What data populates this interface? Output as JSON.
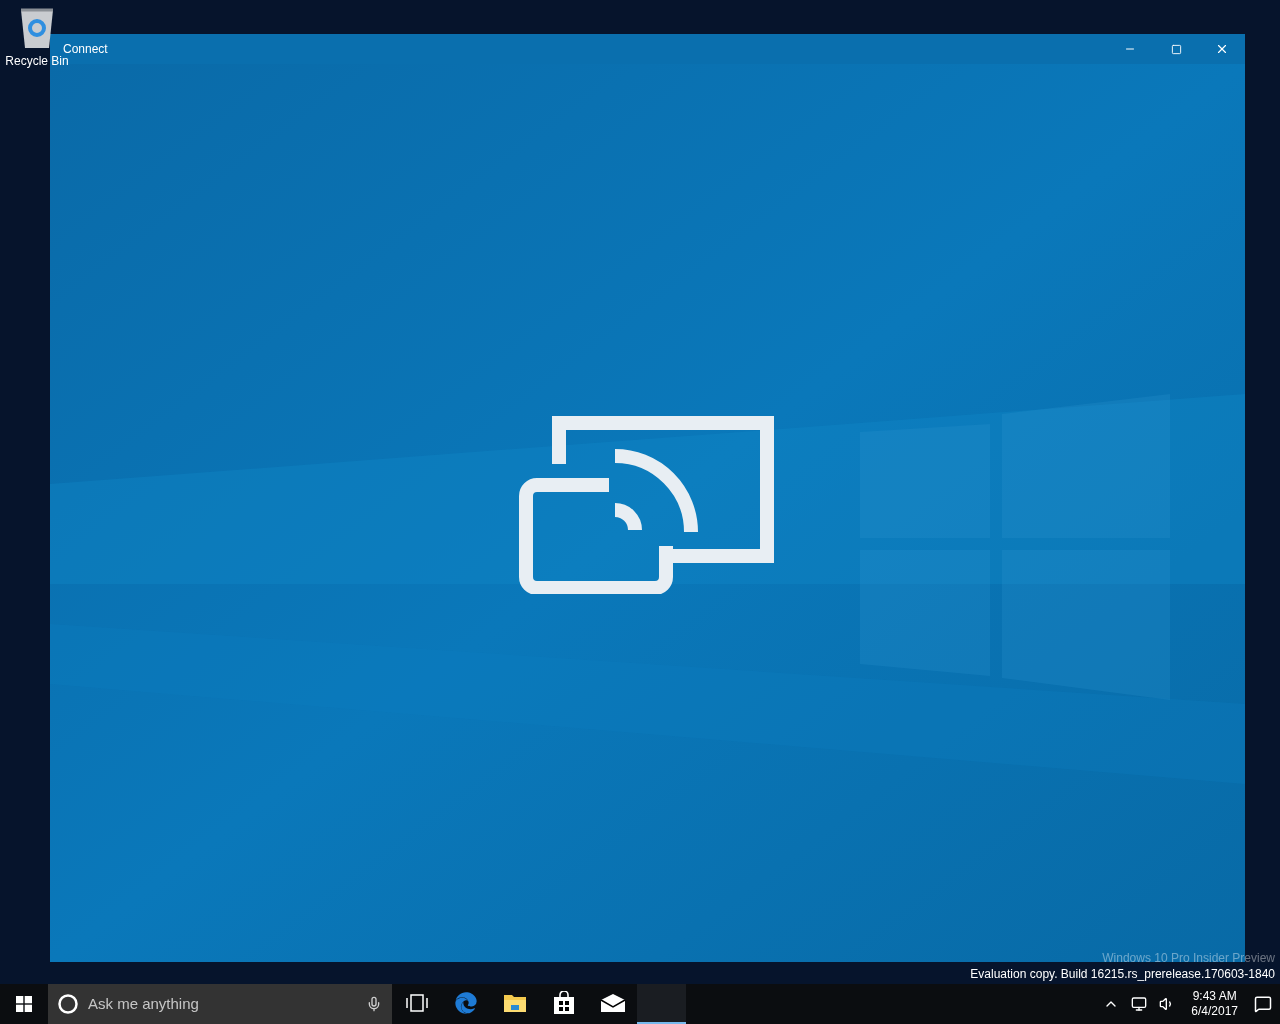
{
  "desktop": {
    "icons": [
      {
        "label": "Recycle Bin"
      }
    ],
    "watermark": [
      "Windows 10 Pro Insider Preview",
      "Evaluation copy. Build 16215.rs_prerelease.170603-1840"
    ]
  },
  "window": {
    "title": "Connect"
  },
  "taskbar": {
    "search": {
      "placeholder": "Ask me anything"
    },
    "apps": [
      {
        "kind": "taskview",
        "running": false
      },
      {
        "kind": "browser",
        "running": false
      },
      {
        "kind": "folder",
        "running": false
      },
      {
        "kind": "store",
        "running": false
      },
      {
        "kind": "mail",
        "running": false
      },
      {
        "kind": "connect",
        "running": true
      }
    ],
    "clock": {
      "time": "9:43 AM",
      "date": "6/4/2017"
    }
  }
}
